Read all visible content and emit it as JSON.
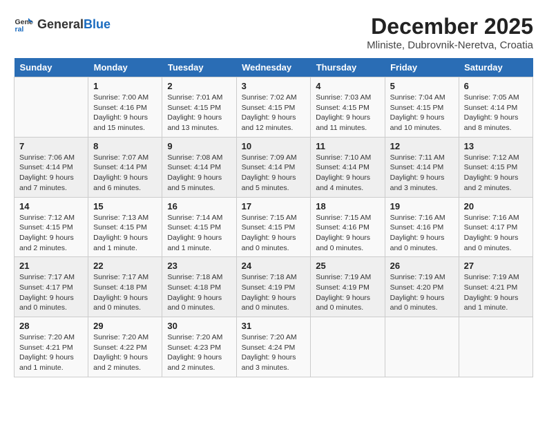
{
  "header": {
    "logo_general": "General",
    "logo_blue": "Blue",
    "title": "December 2025",
    "subtitle": "Mliniste, Dubrovnik-Neretva, Croatia"
  },
  "calendar": {
    "weekdays": [
      "Sunday",
      "Monday",
      "Tuesday",
      "Wednesday",
      "Thursday",
      "Friday",
      "Saturday"
    ],
    "weeks": [
      [
        {
          "day": "",
          "info": ""
        },
        {
          "day": "1",
          "info": "Sunrise: 7:00 AM\nSunset: 4:16 PM\nDaylight: 9 hours\nand 15 minutes."
        },
        {
          "day": "2",
          "info": "Sunrise: 7:01 AM\nSunset: 4:15 PM\nDaylight: 9 hours\nand 13 minutes."
        },
        {
          "day": "3",
          "info": "Sunrise: 7:02 AM\nSunset: 4:15 PM\nDaylight: 9 hours\nand 12 minutes."
        },
        {
          "day": "4",
          "info": "Sunrise: 7:03 AM\nSunset: 4:15 PM\nDaylight: 9 hours\nand 11 minutes."
        },
        {
          "day": "5",
          "info": "Sunrise: 7:04 AM\nSunset: 4:15 PM\nDaylight: 9 hours\nand 10 minutes."
        },
        {
          "day": "6",
          "info": "Sunrise: 7:05 AM\nSunset: 4:14 PM\nDaylight: 9 hours\nand 8 minutes."
        }
      ],
      [
        {
          "day": "7",
          "info": "Sunrise: 7:06 AM\nSunset: 4:14 PM\nDaylight: 9 hours\nand 7 minutes."
        },
        {
          "day": "8",
          "info": "Sunrise: 7:07 AM\nSunset: 4:14 PM\nDaylight: 9 hours\nand 6 minutes."
        },
        {
          "day": "9",
          "info": "Sunrise: 7:08 AM\nSunset: 4:14 PM\nDaylight: 9 hours\nand 5 minutes."
        },
        {
          "day": "10",
          "info": "Sunrise: 7:09 AM\nSunset: 4:14 PM\nDaylight: 9 hours\nand 5 minutes."
        },
        {
          "day": "11",
          "info": "Sunrise: 7:10 AM\nSunset: 4:14 PM\nDaylight: 9 hours\nand 4 minutes."
        },
        {
          "day": "12",
          "info": "Sunrise: 7:11 AM\nSunset: 4:14 PM\nDaylight: 9 hours\nand 3 minutes."
        },
        {
          "day": "13",
          "info": "Sunrise: 7:12 AM\nSunset: 4:15 PM\nDaylight: 9 hours\nand 2 minutes."
        }
      ],
      [
        {
          "day": "14",
          "info": "Sunrise: 7:12 AM\nSunset: 4:15 PM\nDaylight: 9 hours\nand 2 minutes."
        },
        {
          "day": "15",
          "info": "Sunrise: 7:13 AM\nSunset: 4:15 PM\nDaylight: 9 hours\nand 1 minute."
        },
        {
          "day": "16",
          "info": "Sunrise: 7:14 AM\nSunset: 4:15 PM\nDaylight: 9 hours\nand 1 minute."
        },
        {
          "day": "17",
          "info": "Sunrise: 7:15 AM\nSunset: 4:15 PM\nDaylight: 9 hours\nand 0 minutes."
        },
        {
          "day": "18",
          "info": "Sunrise: 7:15 AM\nSunset: 4:16 PM\nDaylight: 9 hours\nand 0 minutes."
        },
        {
          "day": "19",
          "info": "Sunrise: 7:16 AM\nSunset: 4:16 PM\nDaylight: 9 hours\nand 0 minutes."
        },
        {
          "day": "20",
          "info": "Sunrise: 7:16 AM\nSunset: 4:17 PM\nDaylight: 9 hours\nand 0 minutes."
        }
      ],
      [
        {
          "day": "21",
          "info": "Sunrise: 7:17 AM\nSunset: 4:17 PM\nDaylight: 9 hours\nand 0 minutes."
        },
        {
          "day": "22",
          "info": "Sunrise: 7:17 AM\nSunset: 4:18 PM\nDaylight: 9 hours\nand 0 minutes."
        },
        {
          "day": "23",
          "info": "Sunrise: 7:18 AM\nSunset: 4:18 PM\nDaylight: 9 hours\nand 0 minutes."
        },
        {
          "day": "24",
          "info": "Sunrise: 7:18 AM\nSunset: 4:19 PM\nDaylight: 9 hours\nand 0 minutes."
        },
        {
          "day": "25",
          "info": "Sunrise: 7:19 AM\nSunset: 4:19 PM\nDaylight: 9 hours\nand 0 minutes."
        },
        {
          "day": "26",
          "info": "Sunrise: 7:19 AM\nSunset: 4:20 PM\nDaylight: 9 hours\nand 0 minutes."
        },
        {
          "day": "27",
          "info": "Sunrise: 7:19 AM\nSunset: 4:21 PM\nDaylight: 9 hours\nand 1 minute."
        }
      ],
      [
        {
          "day": "28",
          "info": "Sunrise: 7:20 AM\nSunset: 4:21 PM\nDaylight: 9 hours\nand 1 minute."
        },
        {
          "day": "29",
          "info": "Sunrise: 7:20 AM\nSunset: 4:22 PM\nDaylight: 9 hours\nand 2 minutes."
        },
        {
          "day": "30",
          "info": "Sunrise: 7:20 AM\nSunset: 4:23 PM\nDaylight: 9 hours\nand 2 minutes."
        },
        {
          "day": "31",
          "info": "Sunrise: 7:20 AM\nSunset: 4:24 PM\nDaylight: 9 hours\nand 3 minutes."
        },
        {
          "day": "",
          "info": ""
        },
        {
          "day": "",
          "info": ""
        },
        {
          "day": "",
          "info": ""
        }
      ]
    ]
  }
}
